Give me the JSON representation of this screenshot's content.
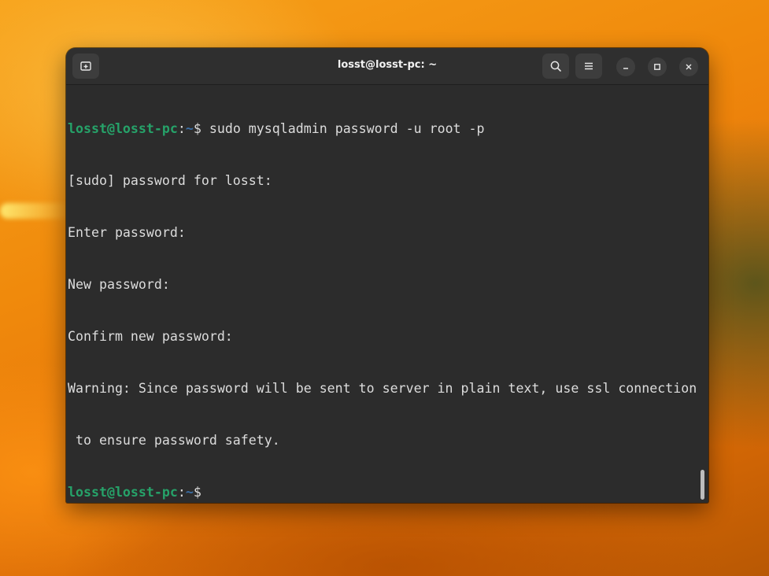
{
  "window": {
    "title": "losst@losst-pc: ~"
  },
  "titlebar": {
    "icons": {
      "new_tab": "new-tab-icon",
      "search": "search-icon",
      "menu": "hamburger-menu-icon",
      "minimize": "minimize-icon",
      "maximize": "maximize-icon",
      "close": "close-icon"
    }
  },
  "terminal": {
    "prompt": {
      "user": "losst@losst-pc",
      "sep": ":",
      "path": "~",
      "symbol": "$ "
    },
    "command": "sudo mysqladmin password -u root -p",
    "output": [
      "[sudo] password for losst:",
      "Enter password:",
      "New password:",
      "Confirm new password:",
      "Warning: Since password will be sent to server in plain text, use ssl connection",
      " to ensure password safety."
    ],
    "final_prompt": {
      "user": "losst@losst-pc",
      "sep": ":",
      "path": "~",
      "symbol": "$"
    }
  },
  "colors": {
    "prompt_user": "#26a269",
    "prompt_path": "#3a6ea5",
    "terminal_bg": "#2c2c2c",
    "text": "#dcdcdc"
  }
}
